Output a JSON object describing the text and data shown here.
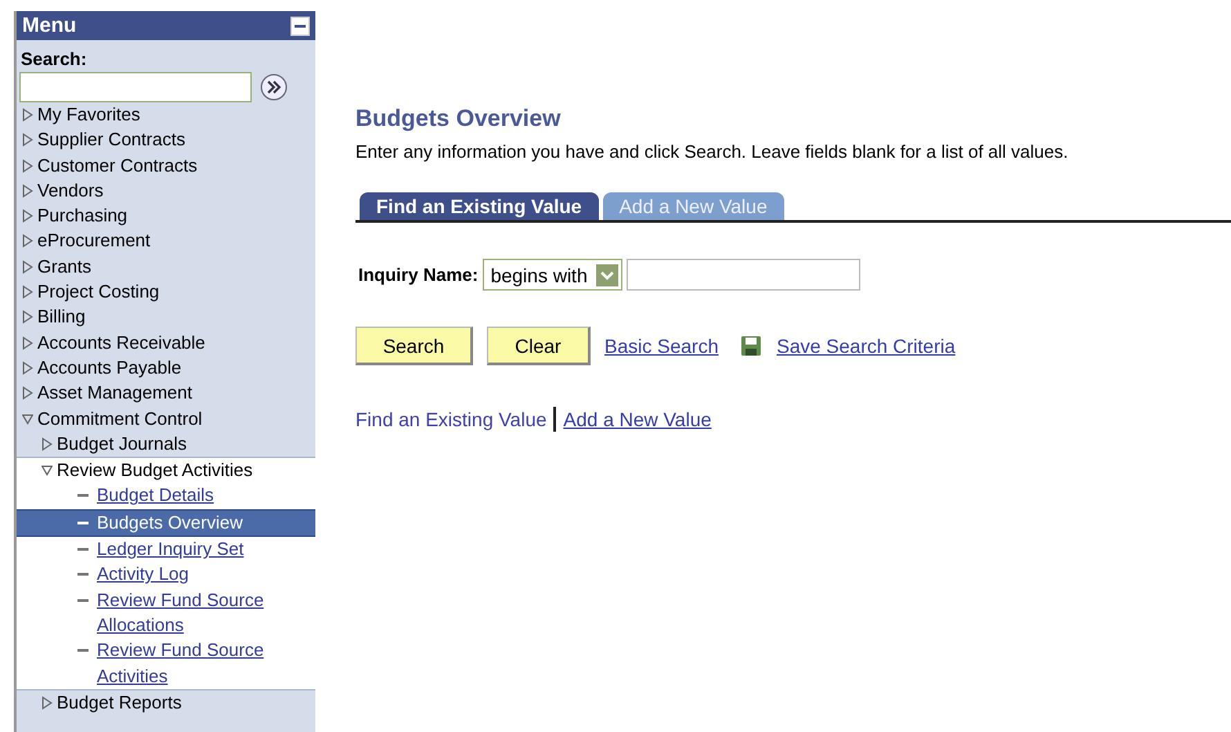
{
  "menu": {
    "title": "Menu",
    "search_label": "Search:",
    "items": [
      {
        "label": "My Favorites",
        "kind": "folder",
        "expanded": false
      },
      {
        "label": "Supplier Contracts",
        "kind": "folder",
        "expanded": false
      },
      {
        "label": "Customer Contracts",
        "kind": "folder",
        "expanded": false
      },
      {
        "label": "Vendors",
        "kind": "folder",
        "expanded": false
      },
      {
        "label": "Purchasing",
        "kind": "folder",
        "expanded": false
      },
      {
        "label": "eProcurement",
        "kind": "folder",
        "expanded": false
      },
      {
        "label": "Grants",
        "kind": "folder",
        "expanded": false
      },
      {
        "label": "Project Costing",
        "kind": "folder",
        "expanded": false
      },
      {
        "label": "Billing",
        "kind": "folder",
        "expanded": false
      },
      {
        "label": "Accounts Receivable",
        "kind": "folder",
        "expanded": false
      },
      {
        "label": "Accounts Payable",
        "kind": "folder",
        "expanded": false
      },
      {
        "label": "Asset Management",
        "kind": "folder",
        "expanded": false
      },
      {
        "label": "Commitment Control",
        "kind": "folder",
        "expanded": true,
        "children": [
          {
            "label": "Budget Journals",
            "kind": "folder",
            "expanded": false
          },
          {
            "label": "Review Budget Activities",
            "kind": "folder",
            "expanded": true,
            "children": [
              {
                "label": "Budget Details",
                "kind": "link",
                "selected": false
              },
              {
                "label": "Budgets Overview",
                "kind": "link",
                "selected": true
              },
              {
                "label": "Ledger Inquiry Set",
                "kind": "link",
                "selected": false
              },
              {
                "label": "Activity Log",
                "kind": "link",
                "selected": false
              },
              {
                "label": "Review Fund Source Allocations",
                "kind": "link",
                "selected": false
              },
              {
                "label": "Review Fund Source Activities",
                "kind": "link",
                "selected": false
              }
            ]
          },
          {
            "label": "Budget Reports",
            "kind": "folder",
            "expanded": false
          }
        ]
      }
    ]
  },
  "page": {
    "title": "Budgets Overview",
    "instructions": "Enter any information you have and click Search. Leave fields blank for a list of all values.",
    "tabs": [
      {
        "label": "Find an Existing Value",
        "selected": true
      },
      {
        "label": "Add a New Value",
        "selected": false
      }
    ],
    "inquiry": {
      "label": "Inquiry Name:",
      "operator": "begins with"
    },
    "buttons": [
      "Search",
      "Clear"
    ],
    "links": [
      "Basic Search",
      "Save Search Criteria"
    ],
    "bottom_links": [
      {
        "label": "Find an Existing Value",
        "selected": true
      },
      {
        "label": "Add a New Value",
        "selected": false
      }
    ]
  }
}
